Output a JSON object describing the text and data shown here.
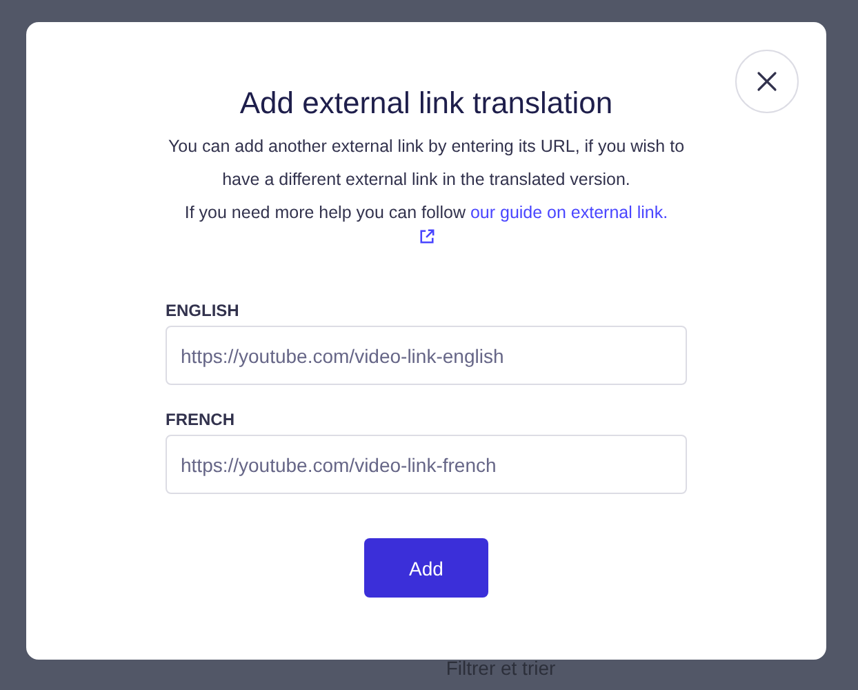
{
  "background": {
    "footer_text": "Filtrer et trier"
  },
  "dialog": {
    "title": "Add external link translation",
    "description": [
      "You can add another external link by entering its URL, if you wish to have a different external link in the translated version.",
      "If you need more help you can follow "
    ],
    "guide_link": "our guide on external link.",
    "fields": [
      {
        "label": "ENGLISH",
        "placeholder": "https://youtube.com/video-link-english"
      },
      {
        "label": "FRENCH",
        "placeholder": "https://youtube.com/video-link-french"
      }
    ],
    "button": "Add"
  }
}
